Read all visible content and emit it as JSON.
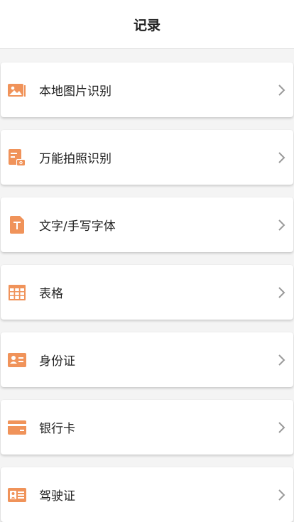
{
  "header": {
    "title": "记录"
  },
  "colors": {
    "accent": "#f0935a",
    "chevron": "#9a9a9a"
  },
  "items": [
    {
      "label": "本地图片识别",
      "icon": "image-icon"
    },
    {
      "label": "万能拍照识别",
      "icon": "photo-document-icon"
    },
    {
      "label": "文字/手写字体",
      "icon": "text-document-icon"
    },
    {
      "label": "表格",
      "icon": "table-icon"
    },
    {
      "label": "身份证",
      "icon": "id-card-icon"
    },
    {
      "label": "银行卡",
      "icon": "bank-card-icon"
    },
    {
      "label": "驾驶证",
      "icon": "driver-license-icon"
    }
  ]
}
